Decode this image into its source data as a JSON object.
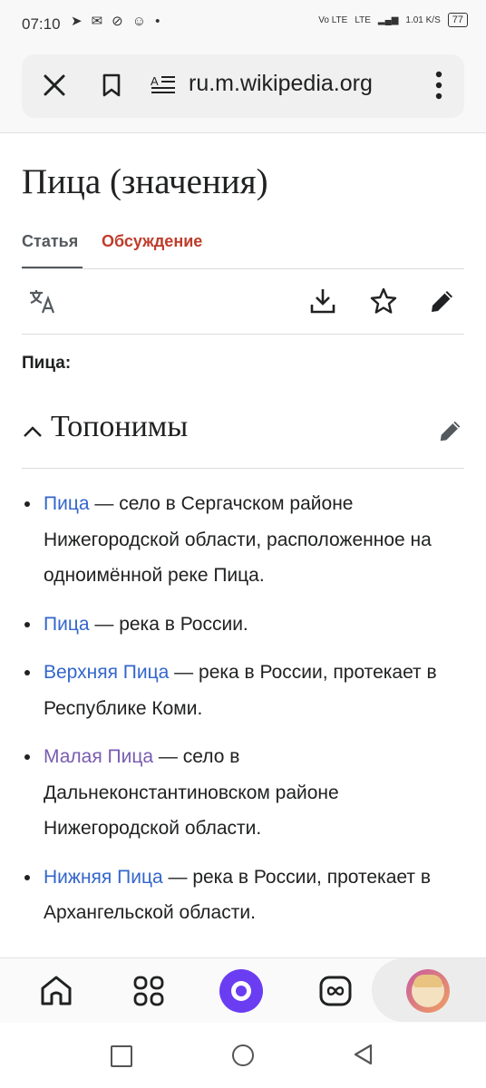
{
  "status_bar": {
    "time": "07:10",
    "network_label_1": "Vo LTE",
    "network_label_2": "LTE",
    "speed": "1.01 K/S",
    "battery": "77"
  },
  "browser": {
    "url": "ru.m.wikipedia.org",
    "icons": [
      "close-icon",
      "bookmark-icon",
      "reader-mode-icon",
      "more-vert-icon"
    ]
  },
  "article": {
    "title": "Пица (значения)",
    "tabs": [
      {
        "label": "Статья",
        "active": true
      },
      {
        "label": "Обсуждение",
        "active": false
      }
    ],
    "actions": [
      "language-icon",
      "download-icon",
      "star-icon",
      "edit-icon"
    ],
    "intro": "Пица:",
    "section": {
      "title": "Топонимы",
      "items": [
        {
          "link": "Пица",
          "text": " — село в Сергачском районе Нижегородской области, расположенное на одноимённой реке Пица.",
          "visited": false
        },
        {
          "link": "Пица",
          "text": " — река в России.",
          "visited": false
        },
        {
          "link": "Верхняя Пица",
          "text": " — река в России, протекает в Республике Коми.",
          "visited": false
        },
        {
          "link": "Малая Пица",
          "text": " — село в Дальнеконстантиновском районе Нижегородской области.",
          "visited": true
        },
        {
          "link": "Нижняя Пица",
          "text": " — река в России, протекает в Архангельской области.",
          "visited": false
        }
      ]
    }
  },
  "colors": {
    "link": "#3366cc",
    "visited_link": "#795cb2",
    "talk_tab": "#bf3c2c",
    "alice": "#6a3df2"
  },
  "bottom_nav": [
    "home-icon",
    "services-grid-icon",
    "alice-icon",
    "tabs-icon",
    "profile-avatar"
  ],
  "system_nav": [
    "recents-icon",
    "home-circle-icon",
    "back-icon"
  ]
}
